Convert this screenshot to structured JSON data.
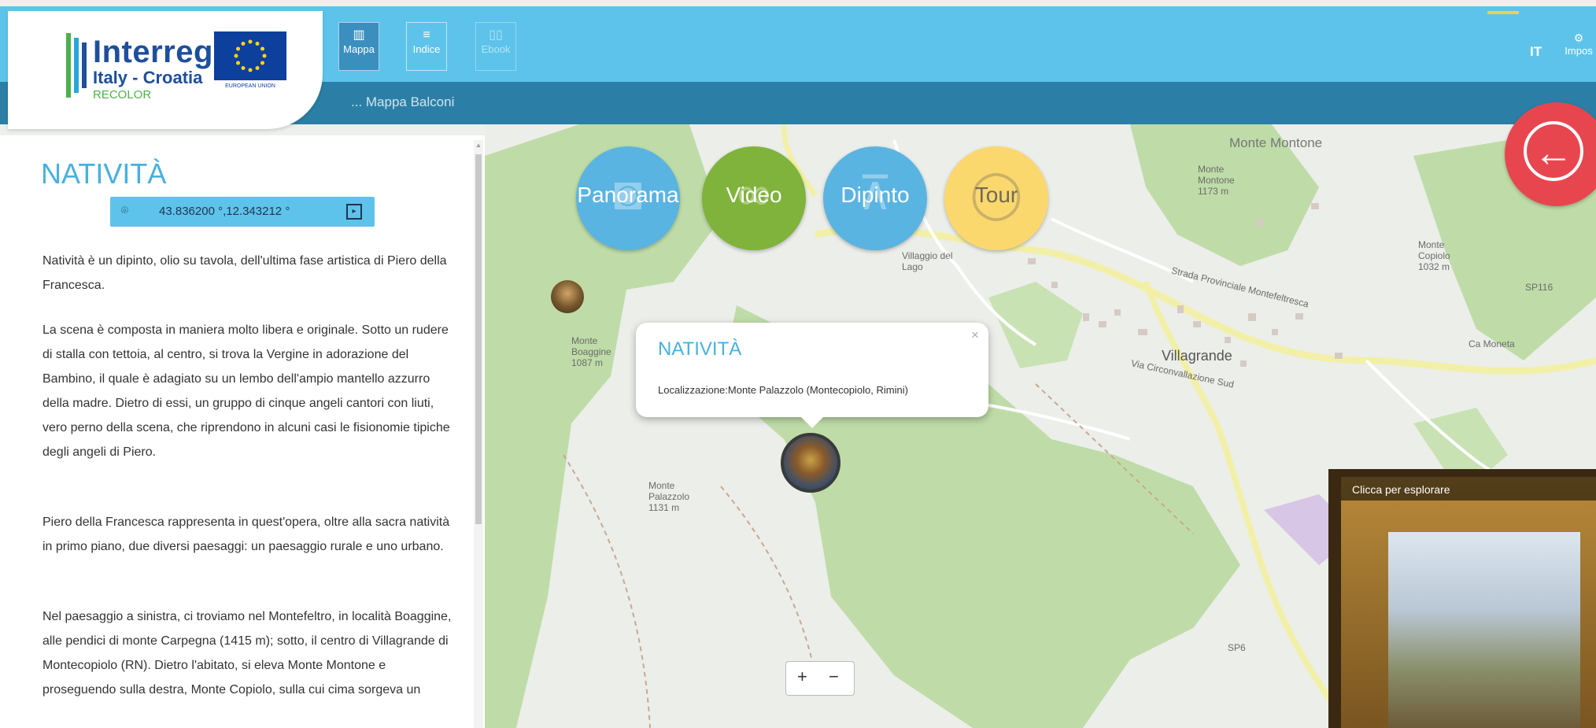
{
  "header": {
    "logo": {
      "program": "Interreg",
      "country": "Italy - Croatia",
      "project": "RECOLOR",
      "eu_label": "EUROPEAN UNION"
    },
    "nav": [
      {
        "label": "Mappa",
        "icon": "map-icon",
        "active": true
      },
      {
        "label": "Indice",
        "icon": "list-icon",
        "active": false
      },
      {
        "label": "Ebook",
        "icon": "book-icon",
        "active": false
      }
    ],
    "language": "IT",
    "settings_label": "Impos",
    "breadcrumb": "... Mappa Balconi"
  },
  "panel": {
    "title": "NATIVITÀ",
    "coordinates": "43.836200 °,12.343212 °",
    "paragraphs": [
      "Natività è un dipinto, olio su tavola, dell'ultima fase artistica di Piero della Francesca.",
      "La scena è composta in maniera molto libera e originale. Sotto un rudere di stalla con tettoia, al centro, si trova la Vergine in adorazione del Bambino, il quale è adagiato su un lembo dell'ampio mantello azzurro della madre. Dietro di essi, un gruppo di cinque angeli cantori con liuti, vero perno della scena, che riprendono in alcuni casi le fisionomie tipiche degli angeli di Piero.",
      "Piero della Francesca rappresenta in quest'opera, oltre alla sacra natività in primo piano, due diversi paesaggi: un paesaggio rurale e uno urbano.",
      "Nel paesaggio a sinistra, ci troviamo nel Montefeltro, in località Boaggine, alle pendici di monte Carpegna (1415 m); sotto, il centro di Villagrande di Montecopiolo (RN). Dietro l'abitato, si eleva Monte Montone e proseguendo sulla destra, Monte Copiolo, sulla cui cima sorgeva un"
    ]
  },
  "map": {
    "buttons": {
      "panorama": "Panorama",
      "video": "Video",
      "dipinto": "Dipinto",
      "tour": "Tour"
    },
    "popup": {
      "title": "NATIVITÀ",
      "text": "Localizzazione:Monte Palazzolo (Montecopiolo, Rimini)",
      "close": "×"
    },
    "zoom_in": "+",
    "zoom_out": "−",
    "painting_hint": "Clicca per esplorare",
    "labels": {
      "monte_montone": "Monte Montone",
      "villagrande": "Villagrande",
      "ca_moneta": "Ca Moneta",
      "sp116": "SP116",
      "sp6": "SP6",
      "monte_palazzolo": "Monte Palazzolo 1131 m",
      "monte_copiolo": "Monte Copiolo 1032 m",
      "monte_montone_peak": "Monte Montone 1173 m",
      "monte_boaggine": "Monte Boaggine 1087 m",
      "villaggio_lago": "Villaggio del Lago",
      "road_1": "Strada Provinciale Montefeltresca",
      "road_2": "Via Circonvallazione Sud"
    }
  }
}
